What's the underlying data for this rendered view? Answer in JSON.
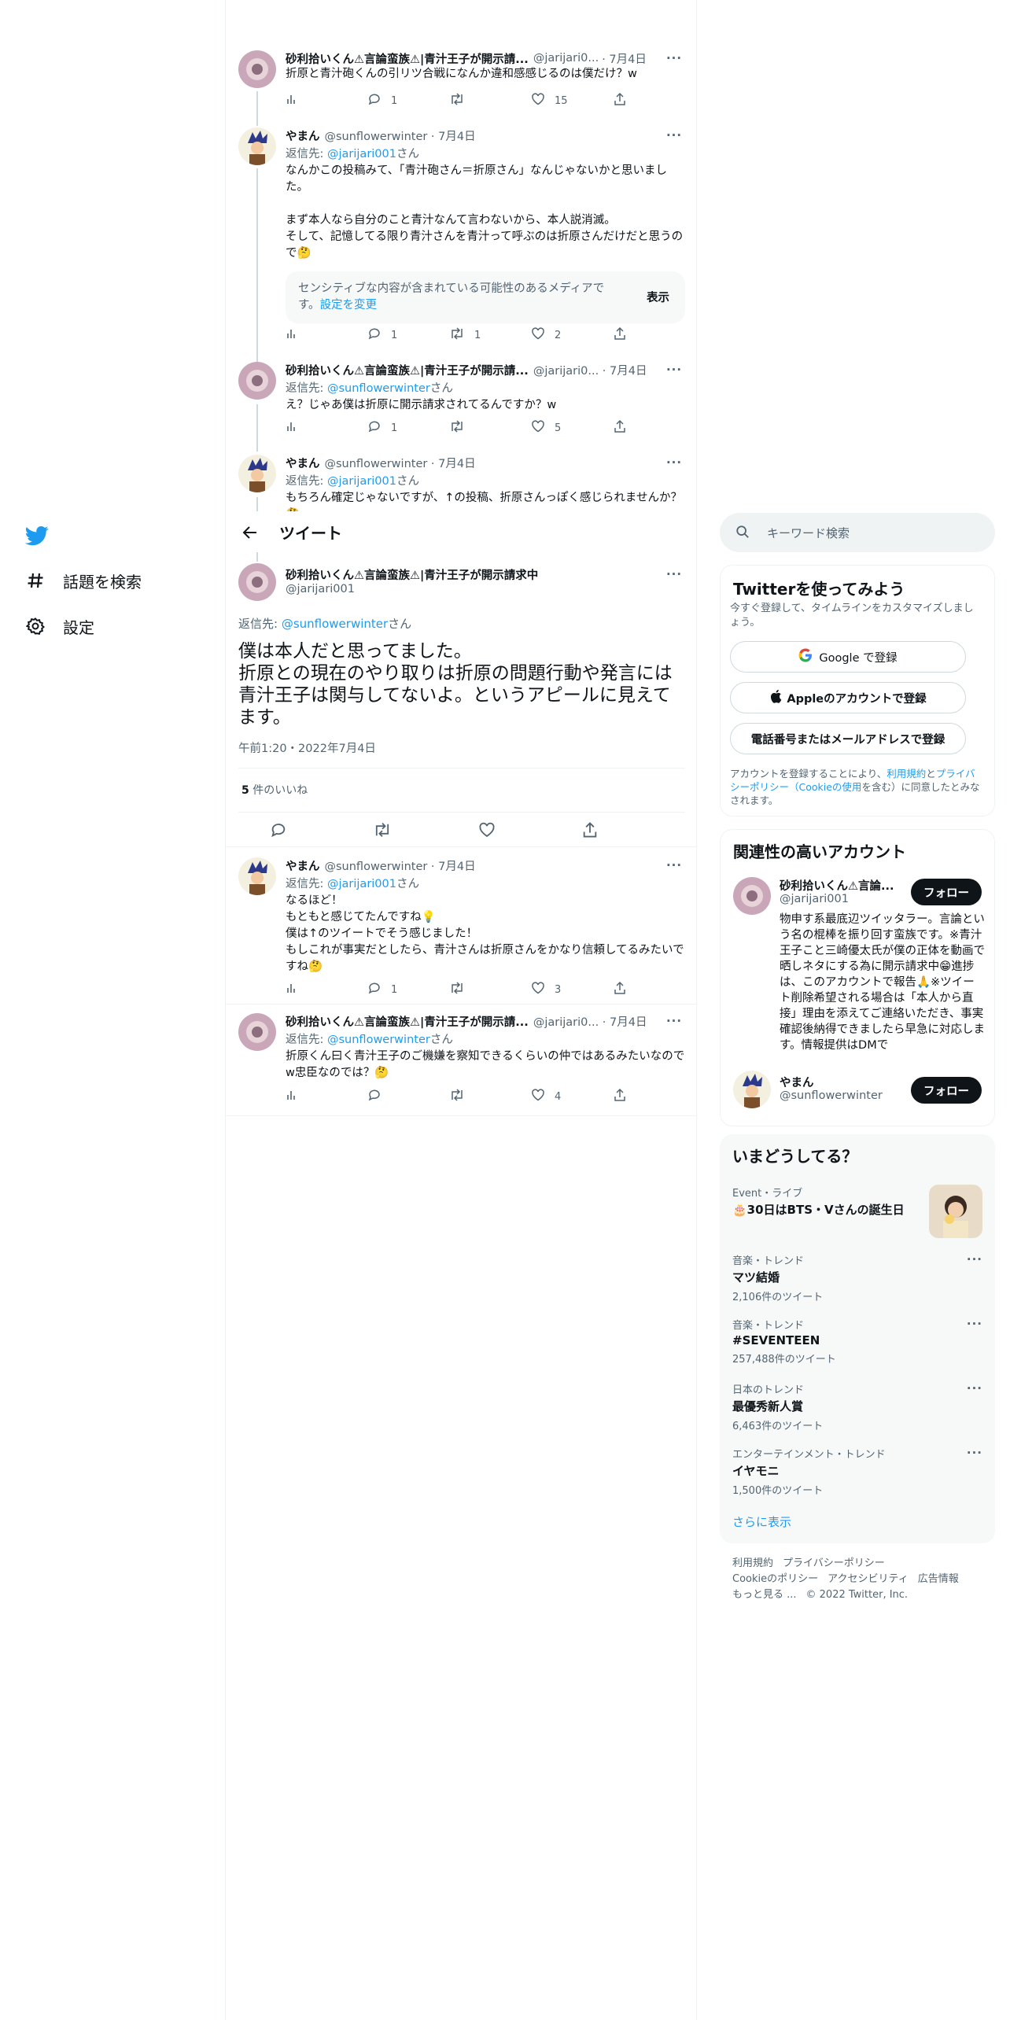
{
  "nav": {
    "items": [
      {
        "label": "話題を検索",
        "icon": "hashtag-icon"
      },
      {
        "label": "設定",
        "icon": "gear-icon"
      }
    ]
  },
  "header": {
    "title": "ツイート"
  },
  "above_tweets": [
    {
      "name": "砂利拾いくん⚠言論蛮族⚠|青汁王子が開示請...",
      "handle": "@jarijari0...",
      "date": "· 7月4日",
      "text": "折原と青汁砲くんの引リツ合戦になんか違和感感じるのは僕だけ？w",
      "counts": {
        "views": "",
        "reply": "1",
        "retweet": "",
        "like": "15"
      }
    },
    {
      "name": "やまん",
      "handle": "@sunflowerwinter · 7月4日",
      "reply_prefix": "返信先: ",
      "reply_to": "@jarijari001",
      "reply_suffix": "さん",
      "text": "なんかこの投稿みて、「青汁砲さん＝折原さん」なんじゃないかと思いました。\n\nまず本人なら自分のこと青汁なんて言わないから、本人説消滅。\nそして、記憶してる限り青汁さんを青汁って呼ぶのは折原さんだけだと思うので🤔",
      "sensitive_msg": "センシティブな内容が含まれている可能性のあるメディアです。",
      "sensitive_link": "設定を変更",
      "sensitive_show": "表示",
      "counts": {
        "views": "",
        "reply": "1",
        "retweet": "1",
        "like": "2"
      }
    },
    {
      "name": "砂利拾いくん⚠言論蛮族⚠|青汁王子が開示請...",
      "handle": "@jarijari0... · 7月4日",
      "reply_prefix": "返信先: ",
      "reply_to": "@sunflowerwinter",
      "reply_suffix": "さん",
      "text": "え？じゃあ僕は折原に開示請求されてるんですか？w",
      "counts": {
        "views": "",
        "reply": "1",
        "retweet": "",
        "like": "5"
      }
    },
    {
      "name": "やまん",
      "handle": "@sunflowerwinter · 7月4日",
      "reply_prefix": "返信先: ",
      "reply_to": "@jarijari001",
      "reply_suffix": "さん",
      "text": "もちろん確定じゃないですが、↑の投稿、折原さんっぽく感じられませんか？🤔"
    }
  ],
  "focal": {
    "name": "砂利拾いくん⚠言論蛮族⚠|青汁王子が開示請求中",
    "handle": "@jarijari001",
    "reply_prefix": "返信先: ",
    "reply_to": "@sunflowerwinter",
    "reply_suffix": "さん",
    "text": "僕は本人だと思ってました。\n折原との現在のやり取りは折原の問題行動や発言には青汁王子は関与してないよ。というアピールに見えてます。",
    "timestamp": "午前1:20・2022年7月4日",
    "likes_count": "5",
    "likes_label": " 件のいいね"
  },
  "replies": [
    {
      "name": "やまん",
      "handle": "@sunflowerwinter · 7月4日",
      "reply_prefix": "返信先: ",
      "reply_to": "@jarijari001",
      "reply_suffix": "さん",
      "text": "なるほど！\nもともと感じてたんですね💡\n僕は↑のツイートでそう感じました！\nもしこれが事実だとしたら、青汁さんは折原さんをかなり信頼してるみたいですね🤔",
      "counts": {
        "views": "",
        "reply": "1",
        "retweet": "",
        "like": "3"
      }
    },
    {
      "name": "砂利拾いくん⚠言論蛮族⚠|青汁王子が開示請...",
      "handle": "@jarijari0... · 7月4日",
      "reply_prefix": "返信先: ",
      "reply_to": "@sunflowerwinter",
      "reply_suffix": "さん",
      "text": "折原くん曰く青汁王子のご機嫌を察知できるくらいの仲ではあるみたいなのでw忠臣なのでは？🤔",
      "counts": {
        "views": "",
        "reply": "",
        "retweet": "",
        "like": "4"
      }
    }
  ],
  "search": {
    "placeholder": "キーワード検索"
  },
  "signup": {
    "title": "Twitterを使ってみよう",
    "subtitle": "今すぐ登録して、タイムラインをカスタマイズしましょう。",
    "google": "Google で登録",
    "apple": "Appleのアカウントで登録",
    "phone": "電話番号またはメールアドレスで登録",
    "terms_1": "アカウントを登録することにより、",
    "terms_link1": "利用規約",
    "terms_2": "と",
    "terms_link2": "プライバシーポリシー（Cookieの使用",
    "terms_3": "を含む）に同意したとみなされます。"
  },
  "who_to_follow": {
    "title": "関連性の高いアカウント",
    "accounts": [
      {
        "name": "砂利拾いくん⚠言論...",
        "handle": "@jarijari001",
        "bio": "物申す系最底辺ツイッタラー。言論という名の棍棒を振り回す蛮族です。※青汁王子こと三崎優太氏が僕の正体を動画で晒しネタにする為に開示請求中😁進捗は、このアカウントで報告🙏※ツイート削除希望される場合は「本人から直接」理由を添えてご連絡いただき、事実確認後納得できましたら早急に対応します。情報提供はDMで",
        "follow": "フォロー"
      },
      {
        "name": "やまん",
        "handle": "@sunflowerwinter",
        "follow": "フォロー"
      }
    ]
  },
  "trends": {
    "title": "いまどうしてる？",
    "items": [
      {
        "category": "Event・ライブ",
        "title": "🎂30日はBTS・Vさんの誕生日",
        "count": ""
      },
      {
        "category": "音楽・トレンド",
        "title": "マツ結婚",
        "count": "2,106件のツイート"
      },
      {
        "category": "音楽・トレンド",
        "title": "#SEVENTEEN",
        "count": "257,488件のツイート"
      },
      {
        "category": "日本のトレンド",
        "title": "最優秀新人賞",
        "count": "6,463件のツイート"
      },
      {
        "category": "エンターテインメント・トレンド",
        "title": "イヤモニ",
        "count": "1,500件のツイート"
      }
    ],
    "show_more": "さらに表示"
  },
  "footer": {
    "links": [
      "利用規約",
      "プライバシーポリシー",
      "Cookieのポリシー",
      "アクセシビリティ",
      "広告情報",
      "もっと見る ..."
    ],
    "copyright": "© 2022 Twitter, Inc."
  },
  "colors": {
    "accent": "#1d9bf0",
    "text": "#0f1419",
    "muted": "#536471"
  }
}
